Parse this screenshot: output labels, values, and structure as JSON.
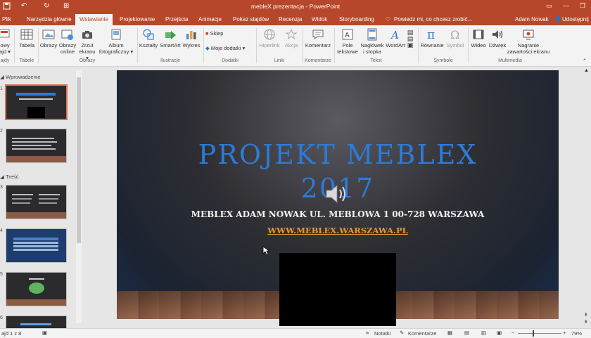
{
  "window": {
    "title": "mebleX prezentacja - PowerPoint",
    "user": "Adam Nowak",
    "share": "Udostępnij",
    "quick_access": {
      "undo": "↶",
      "redo": "↻",
      "customize": "⊞"
    }
  },
  "tabs": [
    {
      "label": "Plik"
    },
    {
      "label": "Narzędzia główne"
    },
    {
      "label": "Wstawianie",
      "active": true
    },
    {
      "label": "Projektowanie"
    },
    {
      "label": "Przejścia"
    },
    {
      "label": "Animacje"
    },
    {
      "label": "Pokaz slajdów"
    },
    {
      "label": "Recenzja"
    },
    {
      "label": "Widok"
    },
    {
      "label": "Storyboarding"
    }
  ],
  "tellme": "Powiedz mi, co chcesz zrobić...",
  "ribbon": {
    "groups": {
      "slides": "ajdy",
      "tables": "Tabele",
      "images": "Obrazy",
      "illustrations": "Ilustracje",
      "addins": "Dodatki",
      "links": "Linki",
      "comments": "Komentarze",
      "text": "Tekst",
      "symbols": "Symbole",
      "multimedia": "Multimedia"
    },
    "buttons": {
      "new_slide_1": "owy",
      "new_slide_2": "ajd ▾",
      "table": "Tabela",
      "images": "Obrazy",
      "online_images_1": "Obrazy",
      "online_images_2": "online",
      "screenshot_1": "Zrzut",
      "screenshot_2": "ekranu ▾",
      "album_1": "Album",
      "album_2": "fotograficzny ▾",
      "shapes": "Kształty",
      "smartart": "SmartArt",
      "chart": "Wykres",
      "store": "Sklep",
      "my_addins": "Moje dodatki",
      "hyperlink": "Hiperlink",
      "action": "Akcja",
      "comment": "Komentarz",
      "textbox_1": "Pole",
      "textbox_2": "tekstowe",
      "header_1": "Nagłówek",
      "header_2": "i stopka",
      "wordart": "WordArt",
      "equation": "Równanie",
      "symbol": "Symbol",
      "video": "Wideo",
      "audio": "Dźwięk",
      "record_1": "Nagranie",
      "record_2": "zawartości ekranu"
    }
  },
  "thumbnails": {
    "sections": [
      "Wprowadzenie",
      "Treść"
    ],
    "slides": [
      "1",
      "2",
      "3",
      "4",
      "5",
      "6"
    ]
  },
  "slide": {
    "title_line1": "PROJEKT MEBLEX",
    "title_line2": "2017",
    "subtitle": "MEBLEX ADAM NOWAK UL. MEBLOWA 1 00-728 WARSZAWA",
    "link": "WWW.MEBLEX.WARSZAWA.PL"
  },
  "status": {
    "slide_count": "ajd 1 z 8",
    "notes": "Notatki",
    "comments": "Komentarze",
    "zoom": "79%",
    "zoom_minus": "−",
    "zoom_plus": "+"
  },
  "colors": {
    "accent": "#b7472a",
    "title_blue": "#2d7bd8",
    "link_orange": "#e89a2c"
  }
}
